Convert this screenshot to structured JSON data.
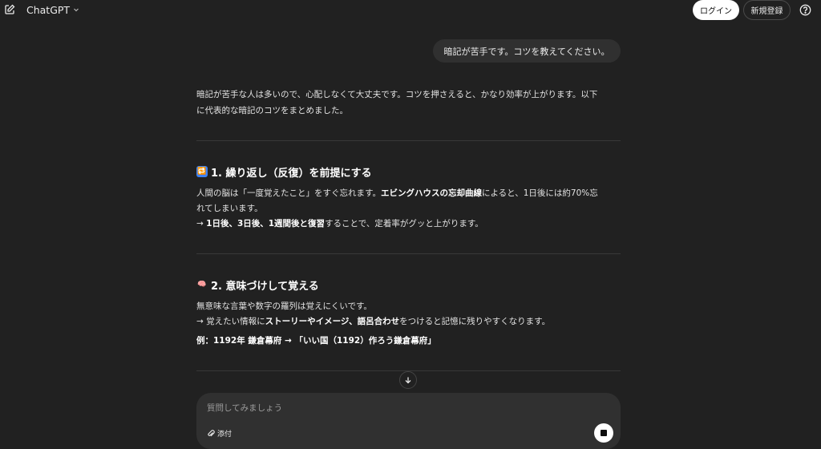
{
  "header": {
    "model_name": "ChatGPT",
    "login_label": "ログイン",
    "signup_label": "新規登録"
  },
  "user_message": "暗記が苦手です。コツを教えてください。",
  "answer": {
    "intro_line1": "暗記が苦手な人は多いので、心配しなくて大丈夫です。コツを押さえると、かなり効率が上がります。以下",
    "intro_line2": "に代表的な暗記のコツをまとめました。",
    "sections": [
      {
        "emoji": "🔁",
        "title": "1. 繰り返し（反復）を前提にする",
        "line1_a": "人間の脳は「一度覚えたこと」をすぐ忘れます。",
        "line1_b": "エビングハウスの忘却曲線",
        "line1_c": "によると、1日後には約70%忘",
        "line2": "れてしまいます。",
        "line3_arrow": "→ ",
        "line3_b": "1日後、3日後、1週間後と復習",
        "line3_c": "することで、定着率がグッと上がります。"
      },
      {
        "emoji": "🧠",
        "title": "2. 意味づけして覚える",
        "line1": "無意味な言葉や数字の羅列は覚えにくいです。",
        "line2_a": "→ 覚えたい情報に",
        "line2_b": "ストーリーやイメージ、語呂合わせ",
        "line2_c": "をつけると記憶に残りやすくなります。",
        "example": "例：1192年 鎌倉幕府 → 「いい国（1192）作ろう鎌倉幕府」"
      }
    ]
  },
  "composer": {
    "placeholder": "質問してみましょう",
    "attach_label": "添付"
  },
  "colors": {
    "background": "#212121",
    "bubble": "#303030",
    "text": "#ececec"
  }
}
